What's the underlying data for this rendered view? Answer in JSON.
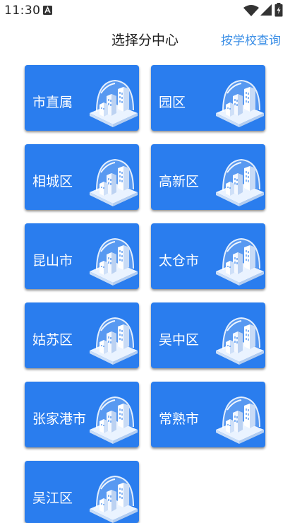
{
  "status_bar": {
    "time": "11:30",
    "left_icon": "a-notification-icon",
    "right_icons": [
      "wifi-icon",
      "signal-icon",
      "battery-icon"
    ]
  },
  "header": {
    "title": "选择分中心",
    "action_label": "按学校查询",
    "action_color": "#3c8fe6"
  },
  "theme": {
    "card_color": "#2a7dee",
    "card_text_color": "#ffffff"
  },
  "regions": [
    {
      "label": "市直属"
    },
    {
      "label": "园区"
    },
    {
      "label": "相城区"
    },
    {
      "label": "高新区"
    },
    {
      "label": "昆山市"
    },
    {
      "label": "太仓市"
    },
    {
      "label": "姑苏区"
    },
    {
      "label": "吴中区"
    },
    {
      "label": "张家港市"
    },
    {
      "label": "常熟市"
    },
    {
      "label": "吴江区"
    }
  ]
}
